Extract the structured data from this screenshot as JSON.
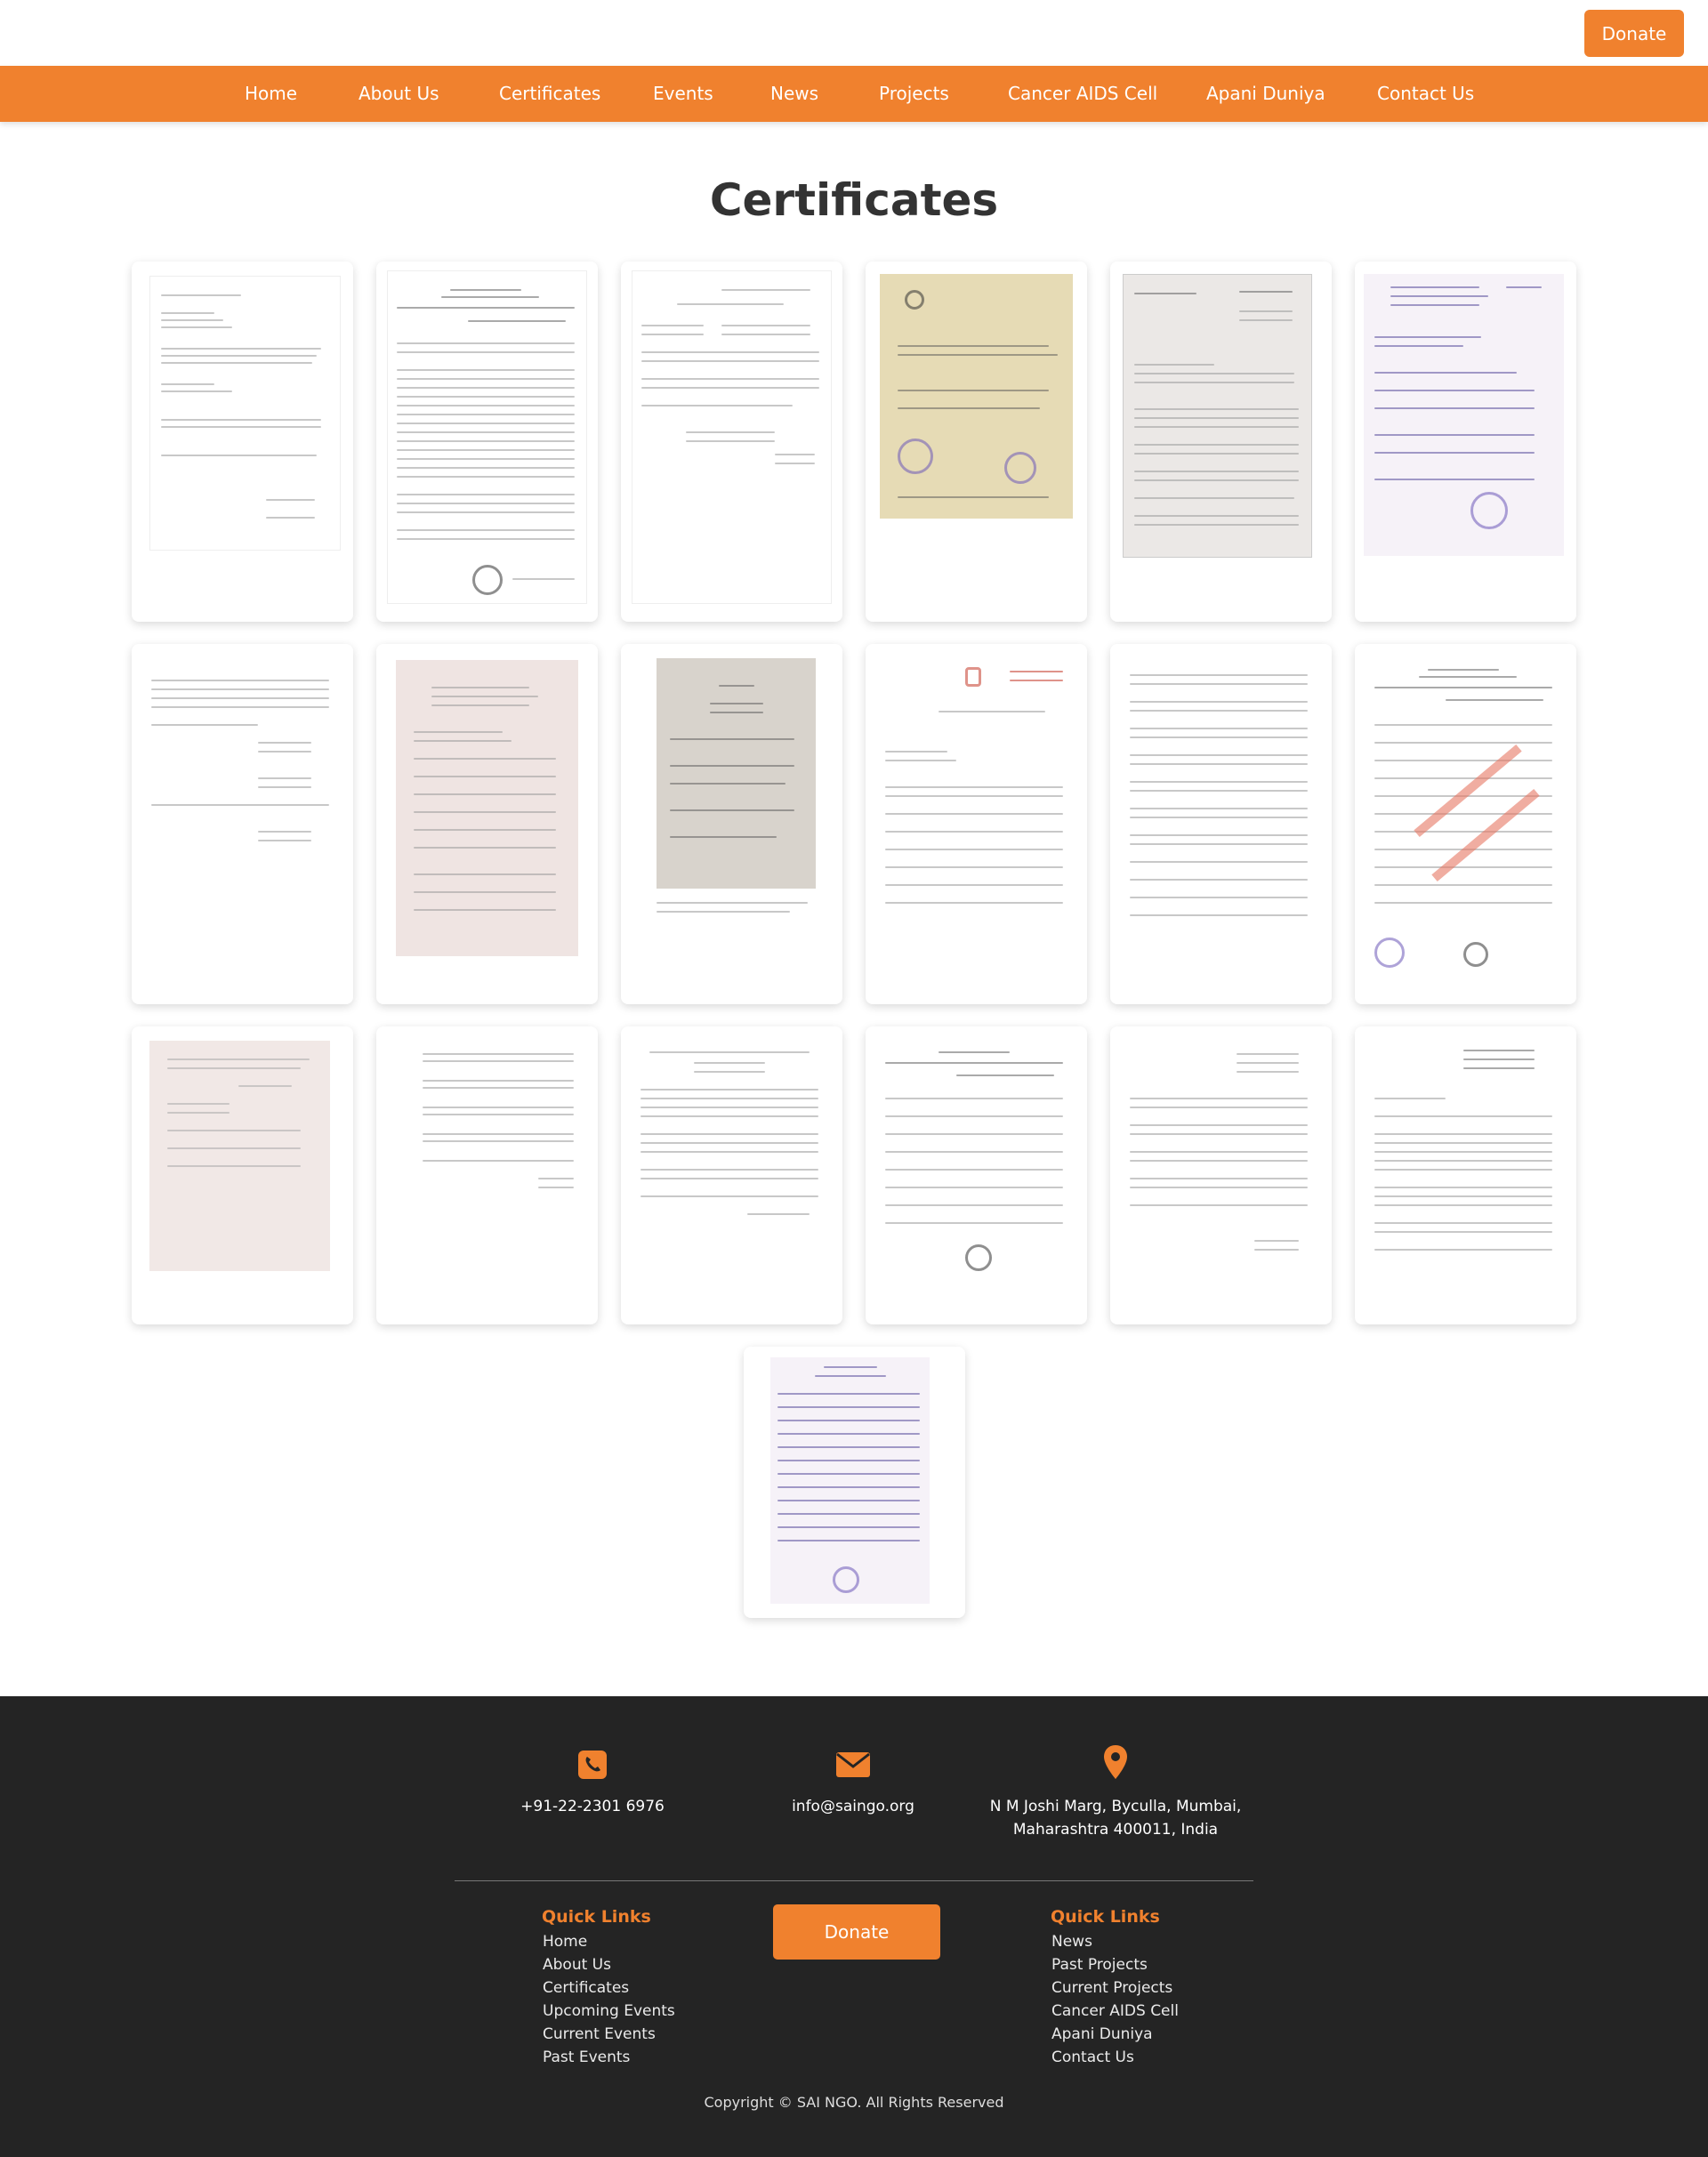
{
  "header": {
    "donate_label": "Donate"
  },
  "nav": {
    "items": [
      {
        "label": "Home"
      },
      {
        "label": "About Us"
      },
      {
        "label": "Certificates"
      },
      {
        "label": "Events"
      },
      {
        "label": "News"
      },
      {
        "label": "Projects"
      },
      {
        "label": "Cancer AIDS Cell"
      },
      {
        "label": "Apani Duniya"
      },
      {
        "label": "Contact Us"
      }
    ]
  },
  "main": {
    "title": "Certificates"
  },
  "footer": {
    "phone": "+91-22-2301 6976",
    "email": "info@saingo.org",
    "address_line1": "N M Joshi Marg, Byculla, Mumbai,",
    "address_line2": "Maharashtra 400011, India",
    "left_links": {
      "title": "Quick Links",
      "items": [
        "Home",
        "About Us",
        "Certificates",
        "Upcoming Events",
        "Current Events",
        "Past Events"
      ]
    },
    "donate_label": "Donate",
    "right_links": {
      "title": "Quick Links",
      "items": [
        "News",
        "Past Projects",
        "Current Projects",
        "Cancer AIDS Cell",
        "Apani Duniya",
        "Contact Us"
      ]
    },
    "copyright": "Copyright © SAI NGO. All Rights Reserved"
  },
  "colors": {
    "accent": "#f0812e",
    "footer_bg": "#242424"
  },
  "icons": {
    "phone": "phone-icon",
    "email": "envelope-icon",
    "address": "map-pin-icon"
  }
}
